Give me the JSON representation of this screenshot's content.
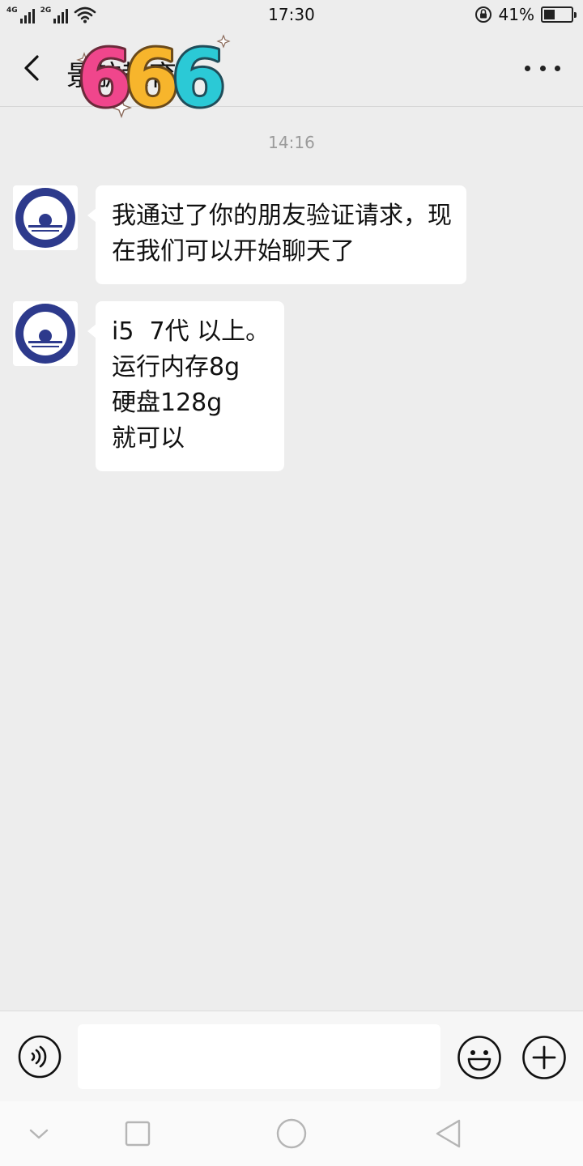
{
  "status_bar": {
    "network_1": "4G",
    "network_2": "2G",
    "time": "17:30",
    "battery_percent": "41%",
    "battery_level": 0.41
  },
  "nav": {
    "title": "景航教育",
    "sticker_text": "666",
    "back_icon": "chevron-left-icon",
    "more_icon": "more-dots-icon"
  },
  "chat": {
    "timestamp": "14:16",
    "messages": [
      {
        "sender_avatar": "logo-avatar",
        "lines": [
          "我通过了你的朋友验证请求，现",
          "在我们可以开始聊天了"
        ]
      },
      {
        "sender_avatar": "logo-avatar",
        "lines": [
          "i5  7代 以上。",
          "运行内存8g",
          "硬盘128g",
          "就可以"
        ]
      }
    ]
  },
  "input_bar": {
    "input_value": "",
    "voice_icon": "voice-icon",
    "emoji_icon": "emoji-icon",
    "plus_icon": "plus-icon"
  },
  "system_nav": {
    "icons": [
      "chevron-down-icon",
      "square-icon",
      "circle-icon",
      "triangle-back-icon"
    ]
  },
  "colors": {
    "background": "#ededed",
    "bubble": "#ffffff",
    "avatar_ring": "#2d3a8c"
  }
}
